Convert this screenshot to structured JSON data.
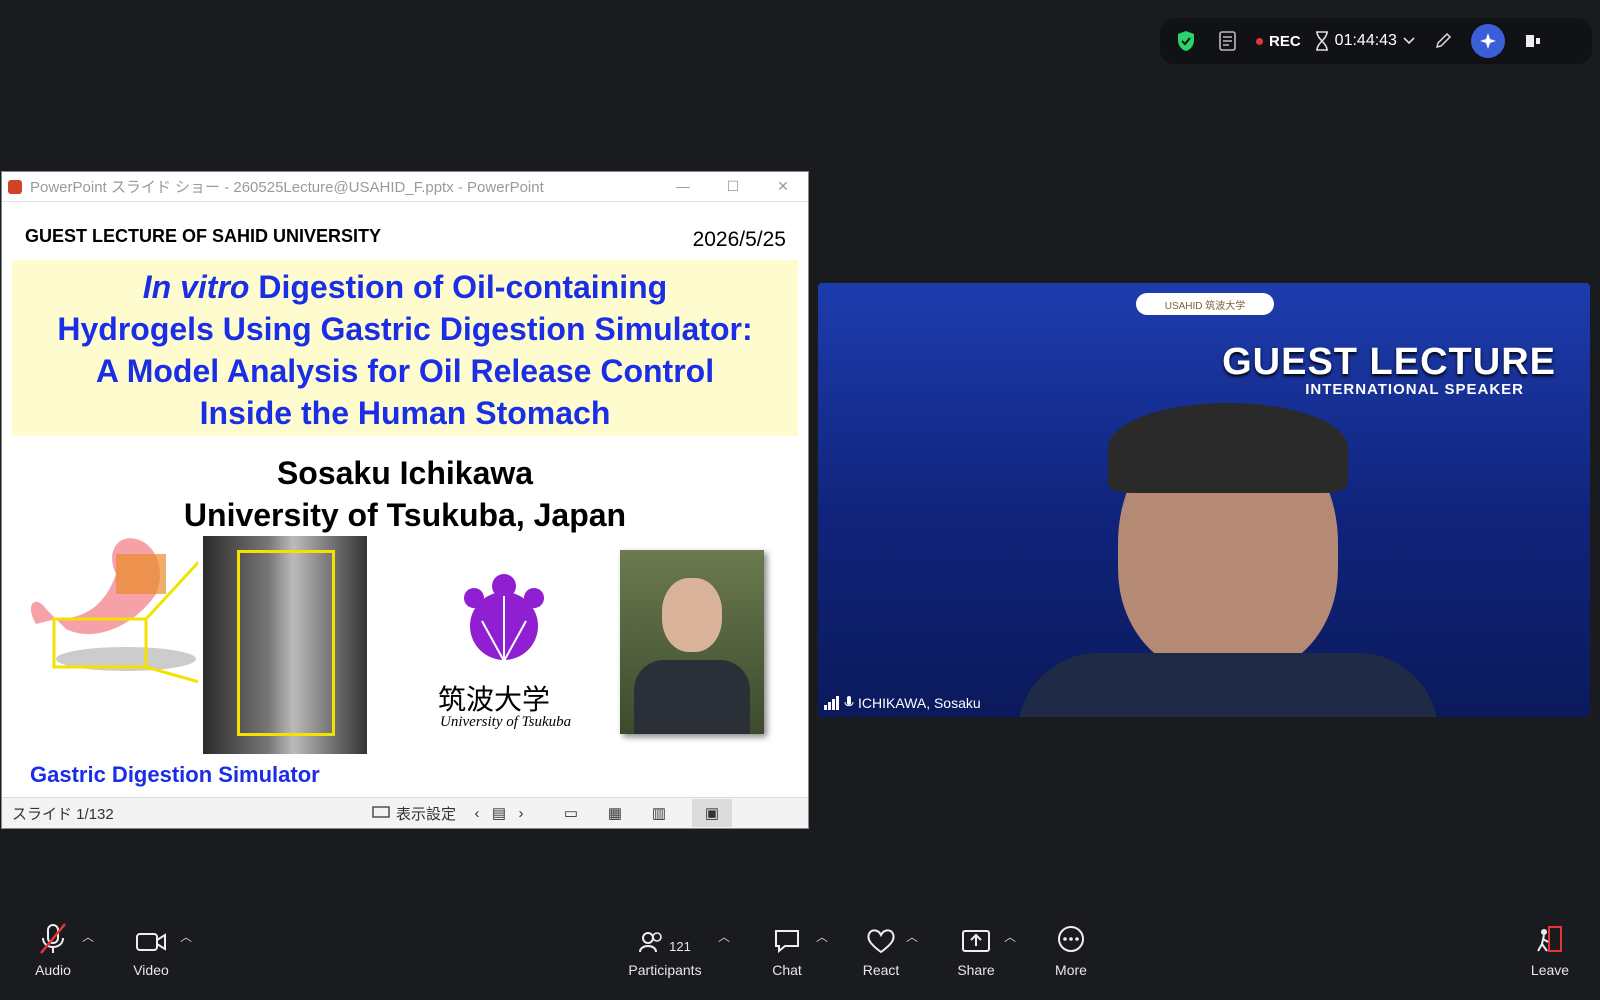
{
  "topbar": {
    "rec_label": "REC",
    "timer": "01:44:43"
  },
  "ppt": {
    "window_title": "PowerPoint スライド ショー  -  260525Lecture@USAHID_F.pptx - PowerPoint",
    "slide": {
      "header": "GUEST LECTURE OF SAHID UNIVERSITY",
      "date": "2026/5/25",
      "title_italic": "In vitro",
      "title_rest_1": " Digestion of Oil-containing",
      "title_line_2": "Hydrogels Using Gastric Digestion Simulator:",
      "title_line_3": "A Model Analysis for Oil Release Control",
      "title_line_4": "Inside the Human Stomach",
      "author": "Sosaku Ichikawa",
      "affiliation": "University of Tsukuba, Japan",
      "univ_name_jp": "筑波大学",
      "univ_name_en": "University of Tsukuba",
      "simulator_caption": "Gastric Digestion Simulator"
    },
    "status": {
      "slide_counter": "スライド 1/132",
      "display_settings": "表示設定"
    }
  },
  "video": {
    "badge_text": "USAHID  筑波大学",
    "banner_title": "GUEST LECTURE",
    "banner_subtitle": "INTERNATIONAL SPEAKER",
    "participant_name": "ICHIKAWA, Sosaku"
  },
  "toolbar": {
    "audio_label": "Audio",
    "video_label": "Video",
    "participants_label": "Participants",
    "participants_count": "121",
    "chat_label": "Chat",
    "react_label": "React",
    "share_label": "Share",
    "more_label": "More",
    "leave_label": "Leave"
  }
}
